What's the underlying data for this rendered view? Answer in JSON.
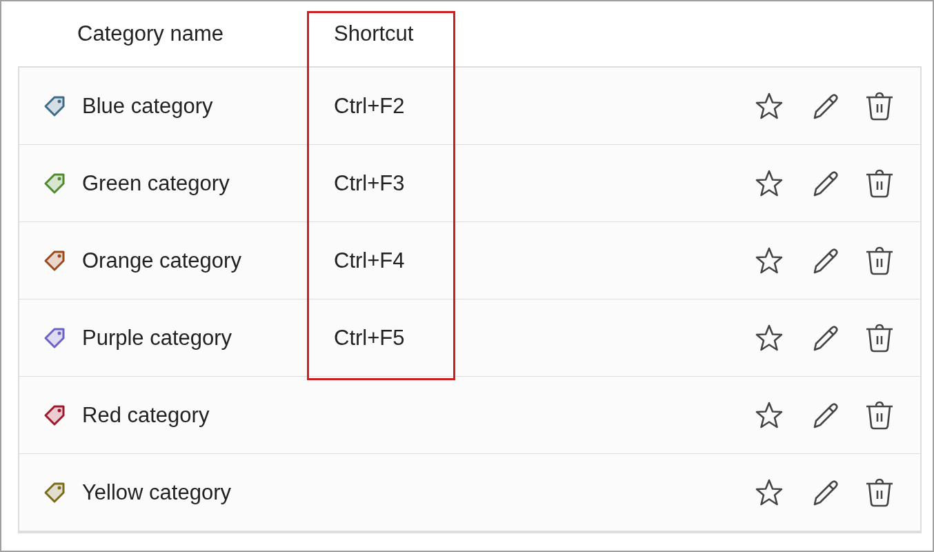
{
  "columns": [
    {
      "label": "Category name",
      "highlighted": false
    },
    {
      "label": "Shortcut",
      "highlighted": true
    }
  ],
  "rows": [
    {
      "name": "Blue category",
      "color": "#3f6b8a",
      "shortcut": "Ctrl+F2"
    },
    {
      "name": "Green category",
      "color": "#4f8a2e",
      "shortcut": "Ctrl+F3"
    },
    {
      "name": "Orange category",
      "color": "#9a4a1c",
      "shortcut": "Ctrl+F4"
    },
    {
      "name": "Purple category",
      "color": "#6a62c4",
      "shortcut": "Ctrl+F5"
    },
    {
      "name": "Red category",
      "color": "#a0182c"
    },
    {
      "name": "Yellow category",
      "color": "#7a6a1a"
    }
  ]
}
